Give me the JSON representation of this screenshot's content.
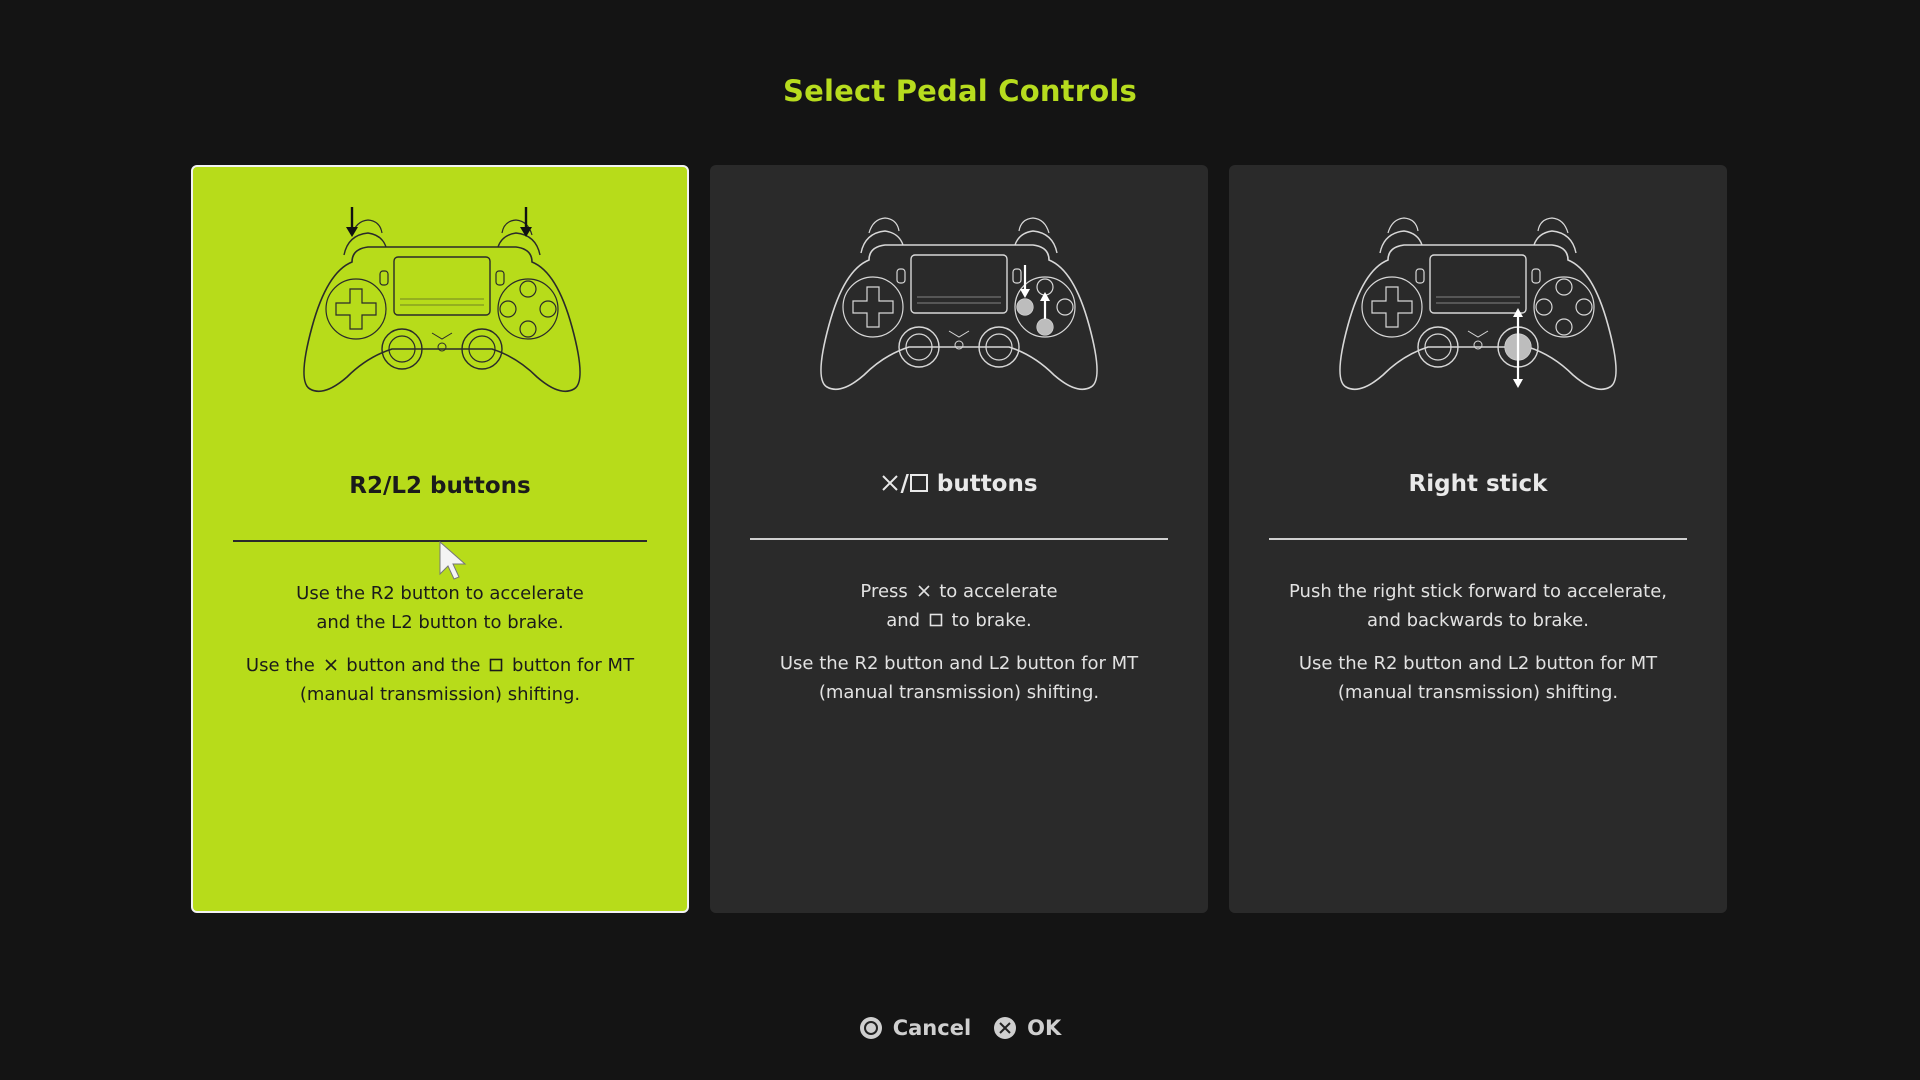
{
  "header": {
    "title": "Select Pedal Controls"
  },
  "cards": [
    {
      "title": "R2/L2 buttons",
      "selected": true,
      "line1": [
        "Use the R2 button to accelerate",
        "and the L2 button to brake."
      ],
      "line2_a": "Use the",
      "line2_b": "button and the",
      "line2_c": "button for MT",
      "line2_d": "(manual transmission) shifting."
    },
    {
      "title_suffix": "buttons",
      "selected": false,
      "p1_a": "Press",
      "p1_b": "to accelerate",
      "p1_c": "and",
      "p1_d": "to brake.",
      "line2": [
        "Use the R2 button and L2 button for MT",
        "(manual transmission) shifting."
      ]
    },
    {
      "title": "Right stick",
      "selected": false,
      "line1": [
        "Push the right stick forward to accelerate,",
        "and backwards to brake."
      ],
      "line2": [
        "Use the R2 button and L2 button for MT",
        "(manual transmission) shifting."
      ]
    }
  ],
  "footer": {
    "cancel_label": "Cancel",
    "ok_label": "OK"
  },
  "colors": {
    "accent": "#b7dc1a",
    "background": "#141414",
    "card": "#2a2a2a"
  },
  "icons": [
    "controller-icon",
    "arrow-down-icon",
    "cross-icon",
    "square-icon",
    "circle-icon",
    "mouse-cursor-icon"
  ]
}
